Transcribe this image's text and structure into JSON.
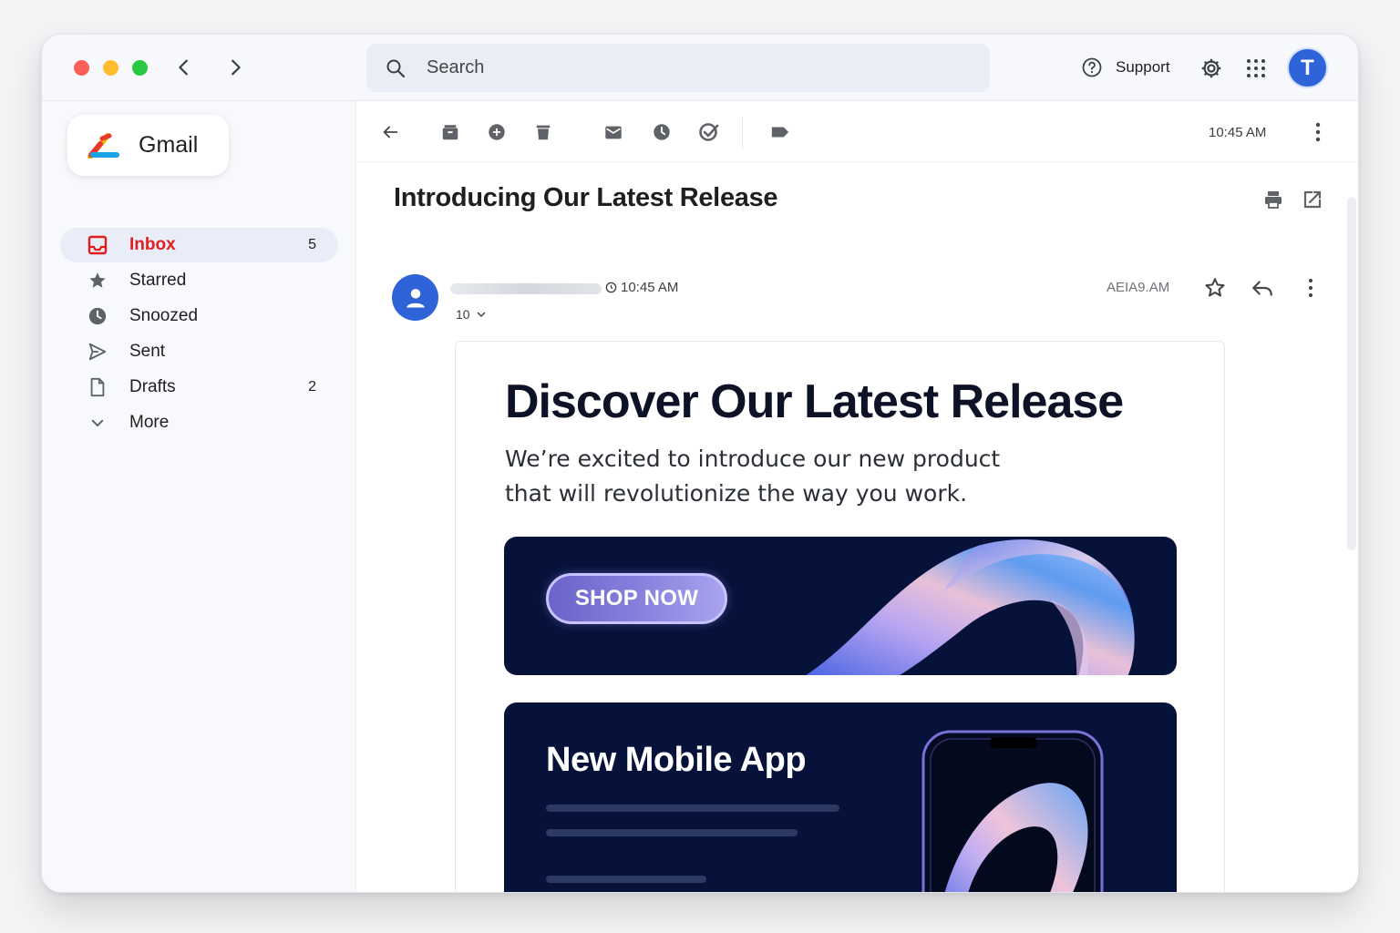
{
  "search": {
    "placeholder": "Search"
  },
  "header": {
    "support_label": "Support",
    "avatar_letter": "T"
  },
  "sidebar": {
    "logo_text": "Gmail",
    "items": [
      {
        "label": "Inbox",
        "count": "5",
        "icon": "inbox-icon",
        "active": true
      },
      {
        "label": "Starred",
        "count": "",
        "icon": "star-icon"
      },
      {
        "label": "Snoozed",
        "count": "",
        "icon": "clock-icon"
      },
      {
        "label": "Sent",
        "count": "",
        "icon": "send-icon"
      },
      {
        "label": "Drafts",
        "count": "2",
        "icon": "draft-icon"
      },
      {
        "label": "More",
        "count": "",
        "icon": "chevron-down-icon"
      }
    ]
  },
  "toolbar": {
    "time": "10:45 AM"
  },
  "email": {
    "subject": "Introducing Our Latest Release",
    "time": "10:45 AM",
    "recipient": "10",
    "mirrored_time": "AEIA9.AM"
  },
  "body": {
    "hero_title": "Discover Our Latest Release",
    "hero_subtitle": "We’re excited to introduce our new product that will revolutionize the way you work.",
    "cta_label": "SHOP NOW",
    "app_title": "New Mobile App"
  },
  "colors": {
    "accent": "#2f63d8",
    "inbox_active": "#e01e1e",
    "banner_bg": "#06123a"
  }
}
